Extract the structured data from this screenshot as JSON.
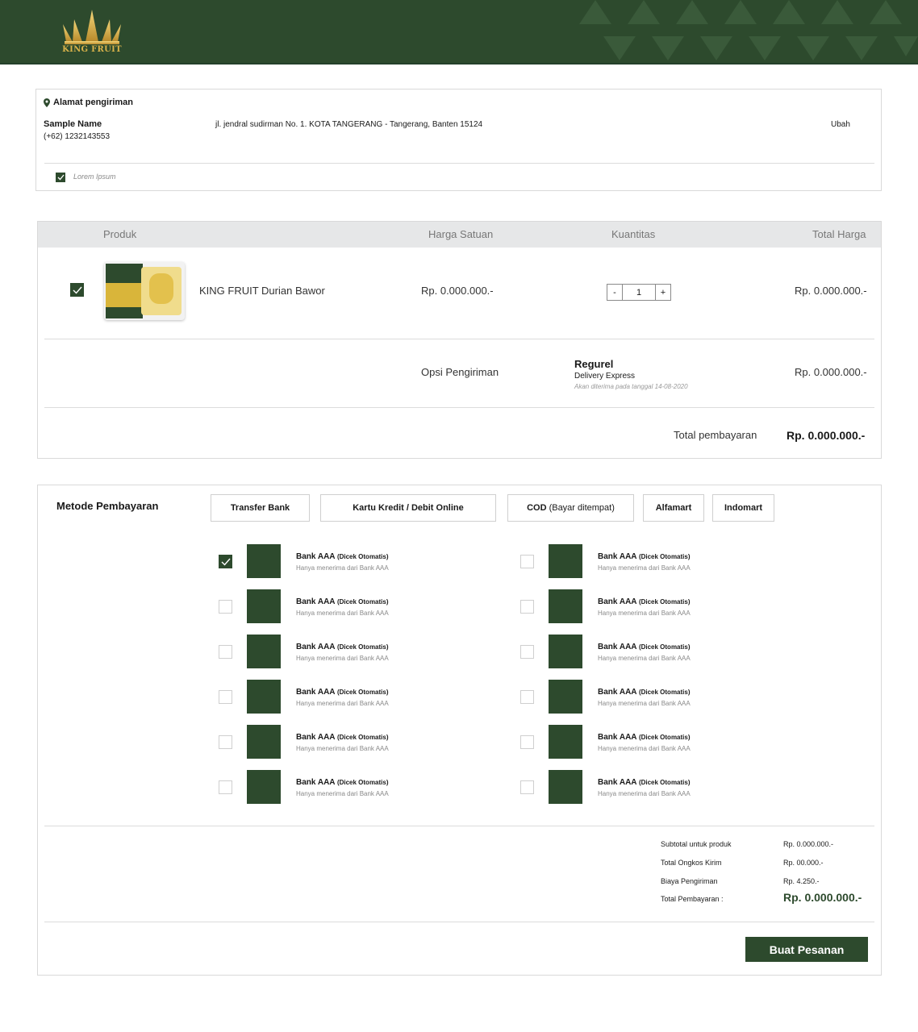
{
  "header": {
    "logo_text": "KING FRUIT",
    "logo_icon": "crown-icon",
    "brand_color": "#2d4a2d",
    "gold_color": "#d8b24a"
  },
  "address": {
    "title": "Alamat pengiriman",
    "name": "Sample Name",
    "phone": "(+62) 1232143553",
    "line": "jl. jendral sudirman No. 1. KOTA TANGERANG - Tangerang, Banten 15124",
    "change_label": "Ubah",
    "checkbox_label": "Lorem Ipsum",
    "checkbox_checked": true
  },
  "products": {
    "columns": [
      "Produk",
      "Harga Satuan",
      "Kuantitas",
      "Total Harga"
    ],
    "item": {
      "name": "KING FRUIT Durian Bawor",
      "price": "Rp. 0.000.000.-",
      "qty_minus": "-",
      "qty": "1",
      "qty_plus": "+",
      "total": "Rp. 0.000.000.-",
      "checked": true
    },
    "shipping": {
      "label": "Opsi Pengiriman",
      "name": "Regurel",
      "type": "Delivery Express",
      "eta": "Akan diterima pada tanggal 14-08-2020",
      "price": "Rp. 0.000.000.-"
    },
    "total_label": "Total pembayaran",
    "total_value": "Rp. 0.000.000.-"
  },
  "payment": {
    "title": "Metode Pembayaran",
    "tabs": [
      {
        "bold": "Transfer Bank",
        "light": ""
      },
      {
        "bold": "Kartu Kredit / Debit Online",
        "light": ""
      },
      {
        "bold": "COD",
        "light": "(Bayar ditempat)"
      },
      {
        "bold": "Alfamart",
        "light": ""
      },
      {
        "bold": "Indomart",
        "light": ""
      }
    ],
    "banks": [
      {
        "name": "Bank AAA",
        "tag": "(Dicek Otomatis)",
        "note": "Hanya menerima  dari Bank AAA",
        "checked": true
      },
      {
        "name": "Bank AAA",
        "tag": "(Dicek Otomatis)",
        "note": "Hanya menerima  dari Bank AAA",
        "checked": false
      },
      {
        "name": "Bank AAA",
        "tag": "(Dicek Otomatis)",
        "note": "Hanya menerima  dari Bank AAA",
        "checked": false
      },
      {
        "name": "Bank AAA",
        "tag": "(Dicek Otomatis)",
        "note": "Hanya menerima  dari Bank AAA",
        "checked": false
      },
      {
        "name": "Bank AAA",
        "tag": "(Dicek Otomatis)",
        "note": "Hanya menerima  dari Bank AAA",
        "checked": false
      },
      {
        "name": "Bank AAA",
        "tag": "(Dicek Otomatis)",
        "note": "Hanya menerima  dari Bank AAA",
        "checked": false
      },
      {
        "name": "Bank AAA",
        "tag": "(Dicek Otomatis)",
        "note": "Hanya menerima  dari Bank AAA",
        "checked": false
      },
      {
        "name": "Bank AAA",
        "tag": "(Dicek Otomatis)",
        "note": "Hanya menerima  dari Bank AAA",
        "checked": false
      },
      {
        "name": "Bank AAA",
        "tag": "(Dicek Otomatis)",
        "note": "Hanya menerima  dari Bank AAA",
        "checked": false
      },
      {
        "name": "Bank AAA",
        "tag": "(Dicek Otomatis)",
        "note": "Hanya menerima  dari Bank AAA",
        "checked": false
      },
      {
        "name": "Bank AAA",
        "tag": "(Dicek Otomatis)",
        "note": "Hanya menerima  dari Bank AAA",
        "checked": false
      },
      {
        "name": "Bank AAA",
        "tag": "(Dicek Otomatis)",
        "note": "Hanya menerima  dari Bank AAA",
        "checked": false
      }
    ],
    "summary": [
      {
        "label": "Subtotal untuk produk",
        "value": "Rp. 0.000.000.-"
      },
      {
        "label": "Total Ongkos Kirim",
        "value": "Rp. 00.000.-"
      },
      {
        "label": "Biaya Pengiriman",
        "value": "Rp. 4.250.-"
      },
      {
        "label": "Total Pembayaran :",
        "value": "Rp. 0.000.000.-"
      }
    ],
    "order_button": "Buat Pesanan"
  }
}
